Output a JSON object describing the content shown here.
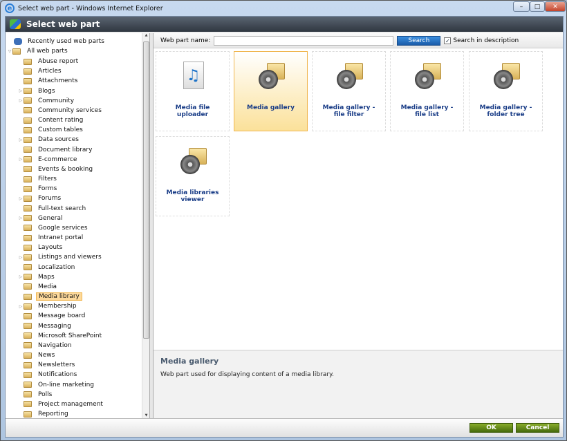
{
  "window": {
    "title": "Select web part - Windows Internet Explorer",
    "minimize": "–",
    "maximize": "□",
    "close": "✕"
  },
  "header": {
    "title": "Select web part"
  },
  "tree": {
    "recent": "Recently used web parts",
    "root": "All web parts",
    "items": [
      {
        "label": "Abuse report",
        "expandable": false
      },
      {
        "label": "Articles",
        "expandable": false
      },
      {
        "label": "Attachments",
        "expandable": false
      },
      {
        "label": "Blogs",
        "expandable": true
      },
      {
        "label": "Community",
        "expandable": true
      },
      {
        "label": "Community services",
        "expandable": false
      },
      {
        "label": "Content rating",
        "expandable": false
      },
      {
        "label": "Custom tables",
        "expandable": false
      },
      {
        "label": "Data sources",
        "expandable": true
      },
      {
        "label": "Document library",
        "expandable": false
      },
      {
        "label": "E-commerce",
        "expandable": true
      },
      {
        "label": "Events & booking",
        "expandable": false
      },
      {
        "label": "Filters",
        "expandable": false
      },
      {
        "label": "Forms",
        "expandable": false
      },
      {
        "label": "Forums",
        "expandable": true
      },
      {
        "label": "Full-text search",
        "expandable": false
      },
      {
        "label": "General",
        "expandable": true
      },
      {
        "label": "Google services",
        "expandable": false
      },
      {
        "label": "Intranet portal",
        "expandable": false
      },
      {
        "label": "Layouts",
        "expandable": false
      },
      {
        "label": "Listings and viewers",
        "expandable": true
      },
      {
        "label": "Localization",
        "expandable": false
      },
      {
        "label": "Maps",
        "expandable": true
      },
      {
        "label": "Media",
        "expandable": false
      },
      {
        "label": "Media library",
        "expandable": false,
        "selected": true
      },
      {
        "label": "Membership",
        "expandable": true
      },
      {
        "label": "Message board",
        "expandable": false
      },
      {
        "label": "Messaging",
        "expandable": false
      },
      {
        "label": "Microsoft SharePoint",
        "expandable": false
      },
      {
        "label": "Navigation",
        "expandable": false
      },
      {
        "label": "News",
        "expandable": false
      },
      {
        "label": "Newsletters",
        "expandable": false
      },
      {
        "label": "Notifications",
        "expandable": false
      },
      {
        "label": "On-line marketing",
        "expandable": false
      },
      {
        "label": "Polls",
        "expandable": false
      },
      {
        "label": "Project management",
        "expandable": false
      },
      {
        "label": "Reporting",
        "expandable": false
      }
    ]
  },
  "toolbar": {
    "name_label": "Web part name:",
    "name_value": "",
    "search_label": "Search",
    "search_in_desc_label": "Search in description",
    "search_in_desc_checked": true
  },
  "tiles": [
    {
      "label": "Media file uploader",
      "icon": "audio-file-icon"
    },
    {
      "label": "Media gallery",
      "icon": "media-gallery-icon",
      "selected": true
    },
    {
      "label": "Media gallery - file filter",
      "icon": "media-gallery-filter-icon"
    },
    {
      "label": "Media gallery - file list",
      "icon": "media-gallery-list-icon"
    },
    {
      "label": "Media gallery - folder tree",
      "icon": "media-gallery-tree-icon"
    },
    {
      "label": "Media libraries viewer",
      "icon": "media-libraries-viewer-icon"
    }
  ],
  "description": {
    "title": "Media gallery",
    "text": "Web part used for displaying content of a media library."
  },
  "footer": {
    "ok": "OK",
    "cancel": "Cancel"
  },
  "colors": {
    "header": "#3a434d",
    "selection": "#fdd99b",
    "tile_text": "#1a3d87",
    "action_button": "#5e8516",
    "search_button": "#1f68b8"
  }
}
